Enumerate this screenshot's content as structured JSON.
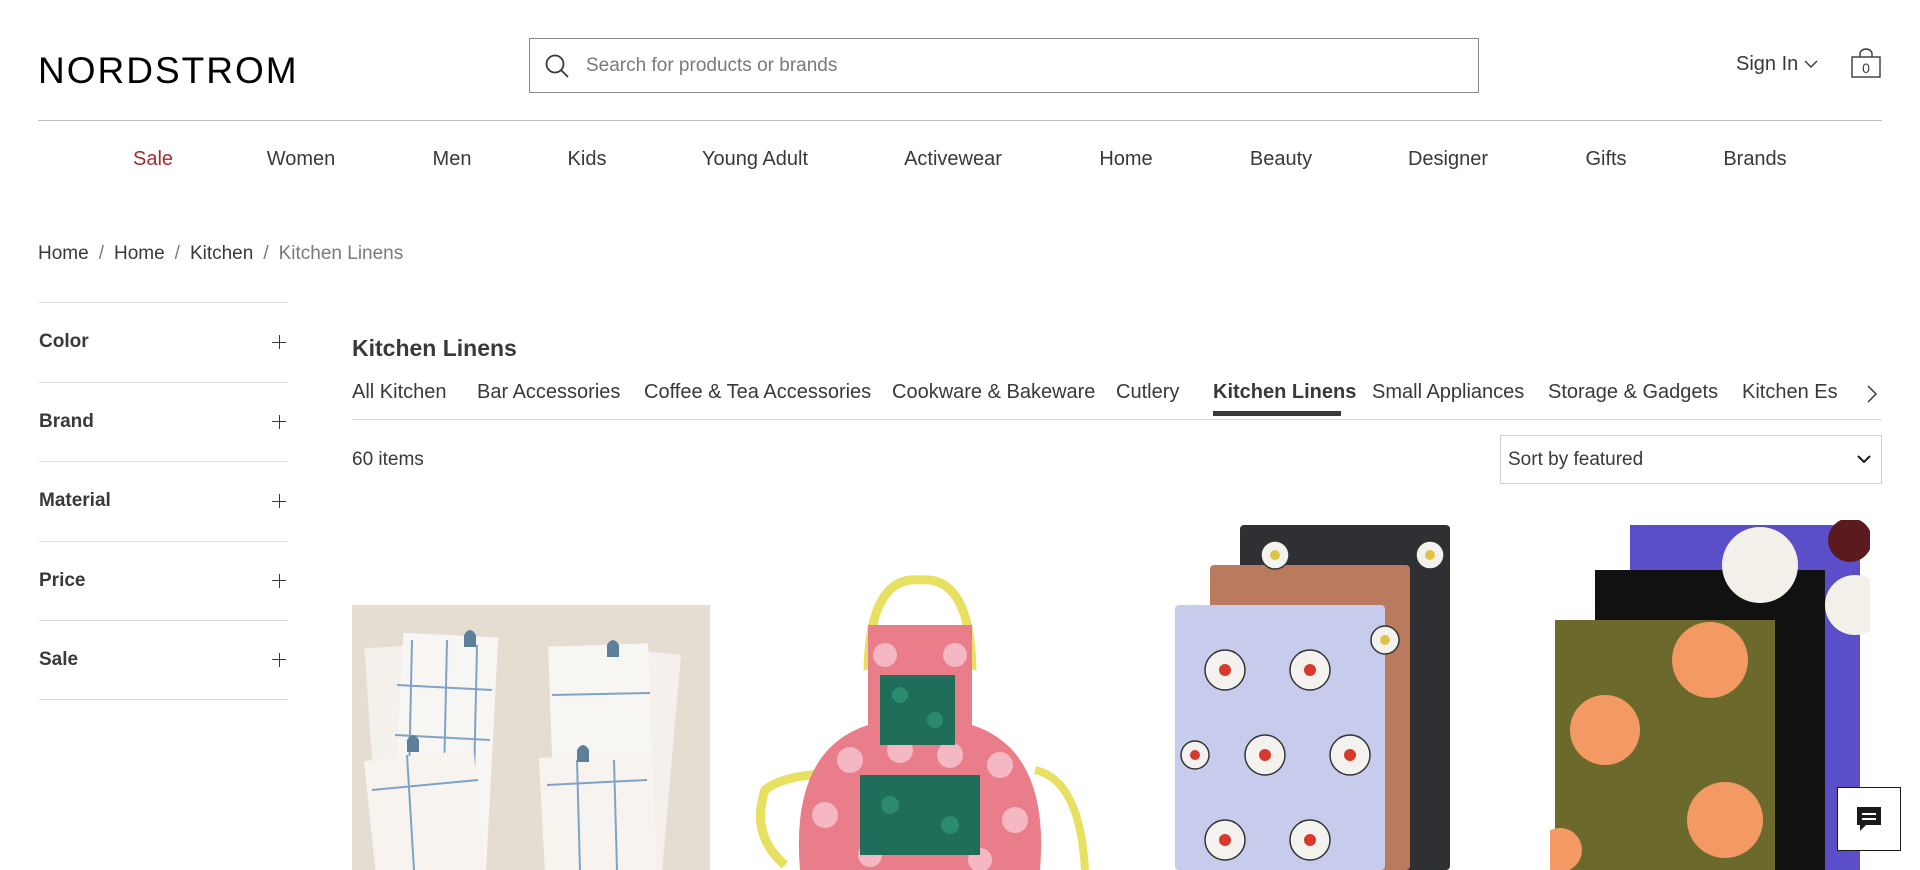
{
  "header": {
    "logo": "NORDSTROM",
    "search_placeholder": "Search for products or brands",
    "sign_in": "Sign In",
    "bag_count": "0"
  },
  "nav": [
    {
      "label": "Sale"
    },
    {
      "label": "Women"
    },
    {
      "label": "Men"
    },
    {
      "label": "Kids"
    },
    {
      "label": "Young Adult"
    },
    {
      "label": "Activewear"
    },
    {
      "label": "Home"
    },
    {
      "label": "Beauty"
    },
    {
      "label": "Designer"
    },
    {
      "label": "Gifts"
    },
    {
      "label": "Brands"
    }
  ],
  "breadcrumb": [
    "Home",
    "Home",
    "Kitchen",
    "Kitchen Linens"
  ],
  "filters": [
    "Color",
    "Brand",
    "Material",
    "Price",
    "Sale"
  ],
  "page_title": "Kitchen Linens",
  "tabs": [
    "All Kitchen",
    "Bar Accessories",
    "Coffee & Tea Accessories",
    "Cookware & Bakeware",
    "Cutlery",
    "Kitchen Linens",
    "Small Appliances",
    "Storage & Gadgets",
    "Kitchen Es"
  ],
  "active_tab": "Kitchen Linens",
  "item_count": "60 items",
  "sort": {
    "selected": "Sort by featured"
  },
  "colors": {
    "sale": "#9b2e35",
    "text": "#393939",
    "rule": "#dcdcdc"
  }
}
